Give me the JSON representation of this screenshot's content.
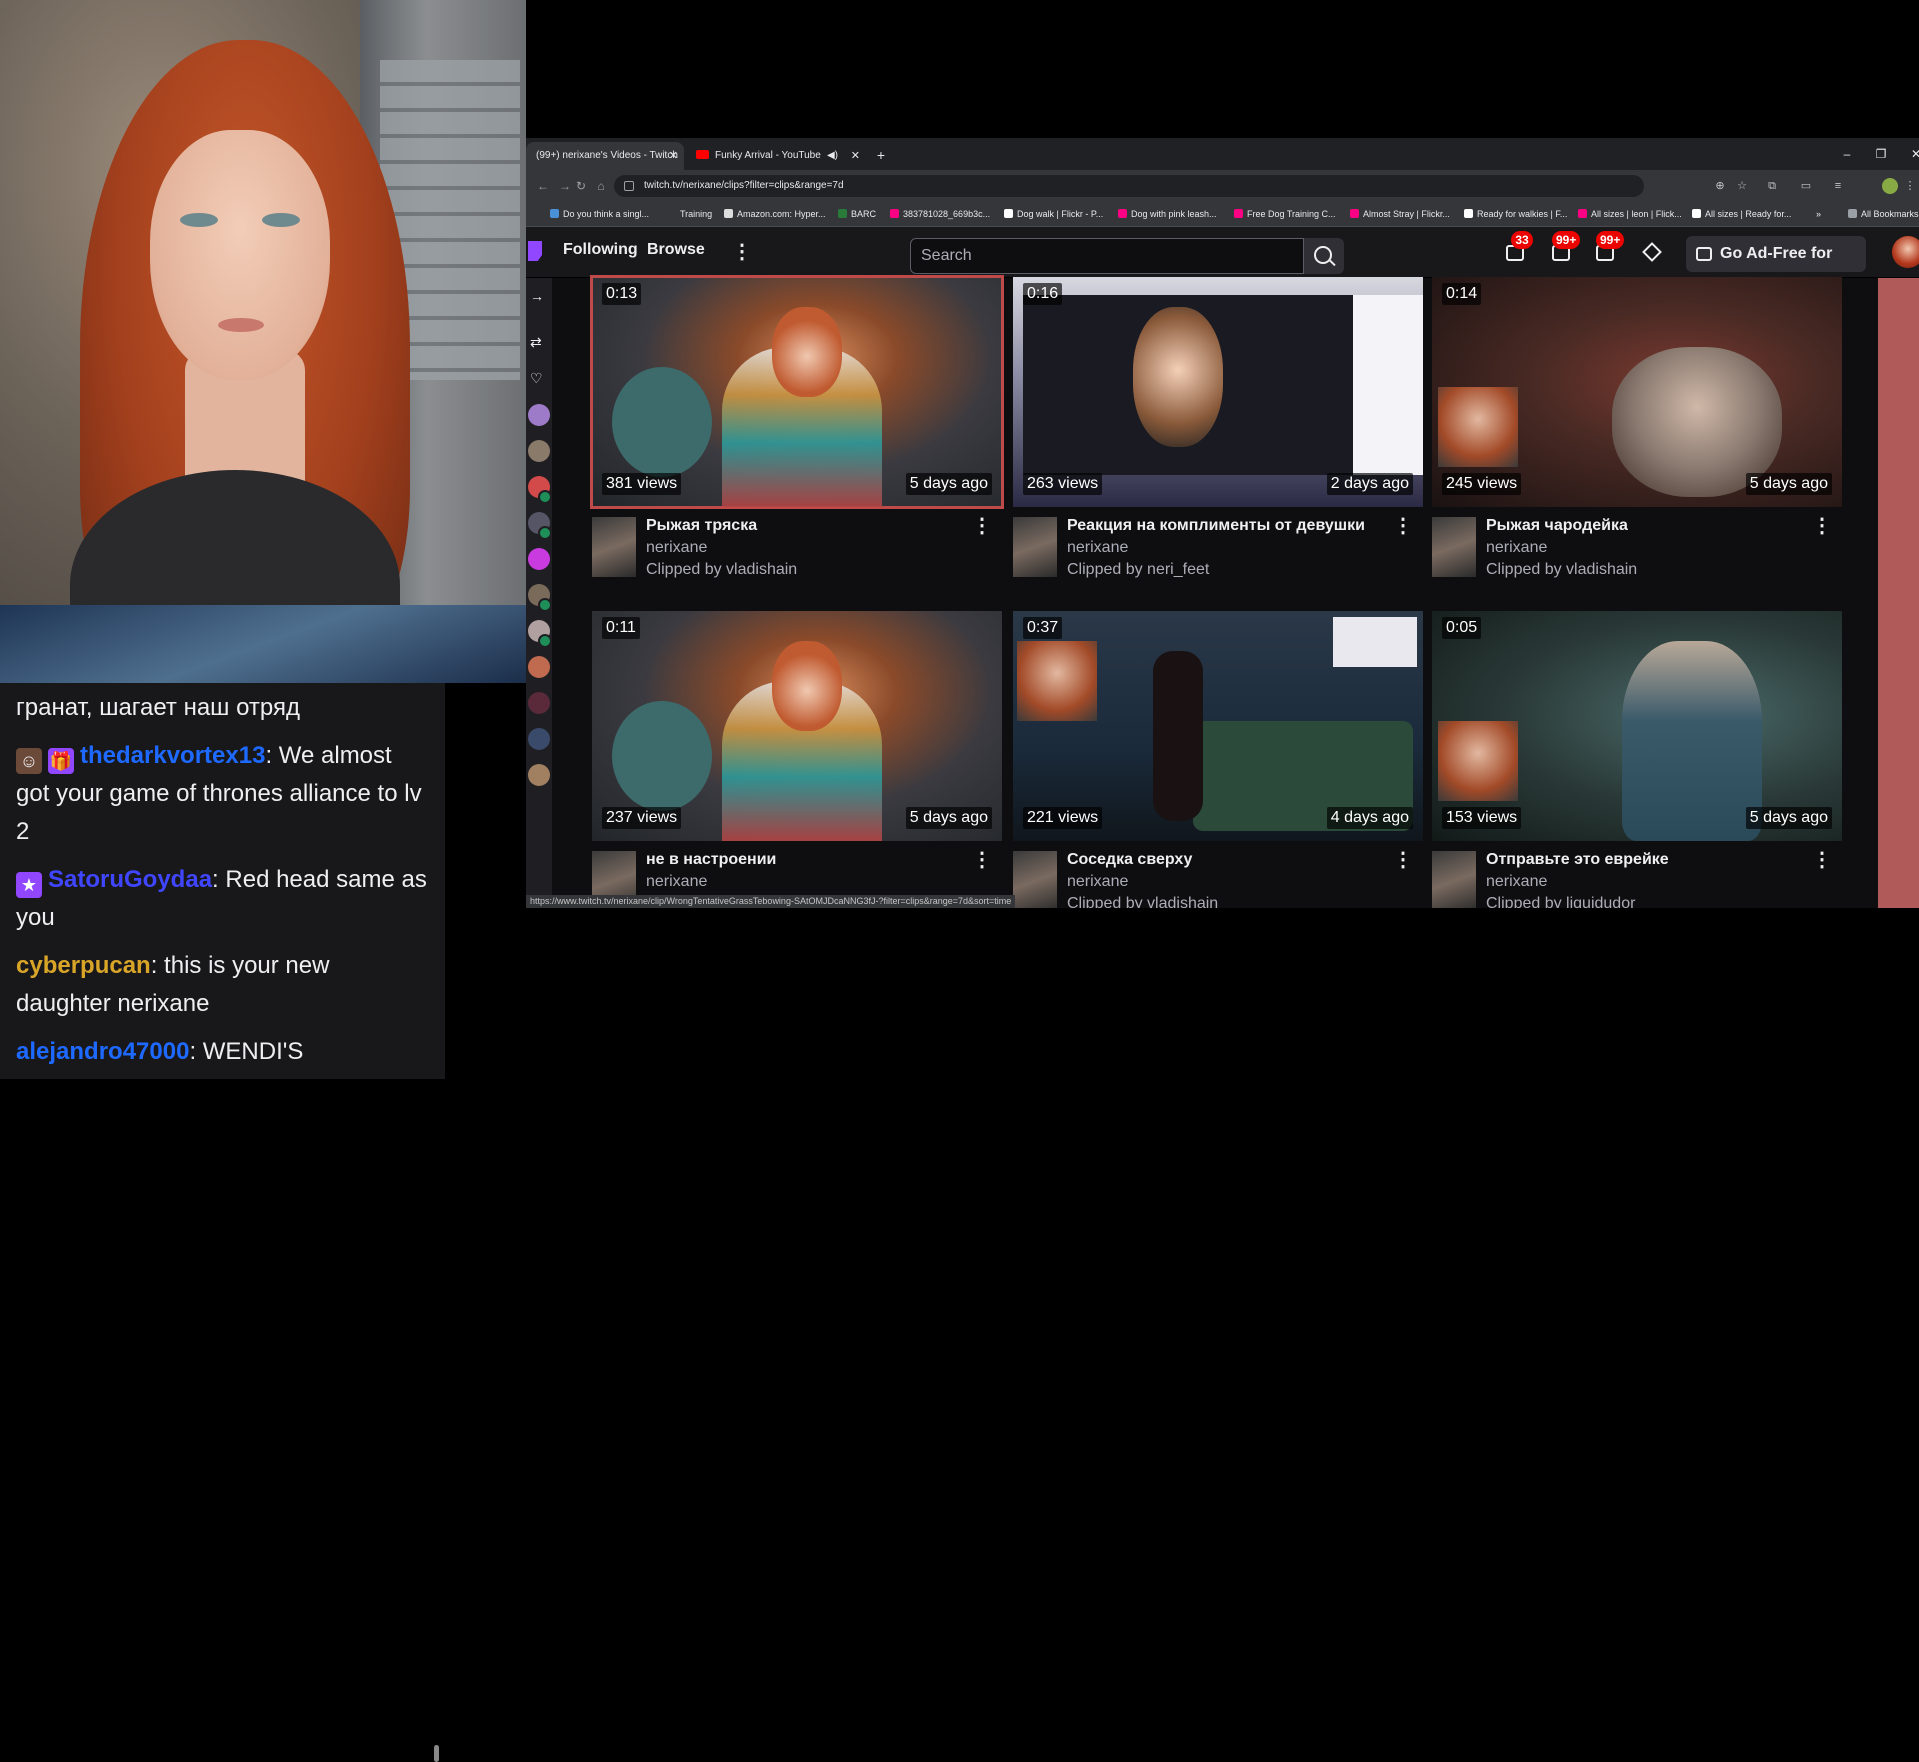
{
  "chat": {
    "partial_line": "гранат, шагает наш отряд",
    "messages": [
      {
        "user": "thedarkvortex13",
        "text": ": We almost got your game of thrones alliance to lv 2",
        "color": "#1e69ff"
      },
      {
        "user": "SatoruGoydaa",
        "text": ": Red head same as you",
        "color": "#4046ff"
      },
      {
        "user": "cyberpucan",
        "text": ": this is your new daughter nerixane",
        "color": "#d8a528"
      },
      {
        "user": "alejandro47000",
        "text": ": WENDI'S",
        "color": "#1e69ff"
      }
    ]
  },
  "browser": {
    "tabs": [
      {
        "title": "(99+) nerixane's Videos - Twitch",
        "active": true
      },
      {
        "title": "Funky Arrival - YouTube",
        "active": false
      }
    ],
    "new_tab": "+",
    "url": "twitch.tv/nerixane/clips?filter=clips&range=7d",
    "bookmarks": [
      {
        "label": "Do you think a singl...",
        "color": "#4a90d9"
      },
      {
        "label": "Training",
        "color": ""
      },
      {
        "label": "Amazon.com: Hyper...",
        "color": "#dddddd"
      },
      {
        "label": "BARC",
        "color": "#2a7a3a"
      },
      {
        "label": "383781028_669b3c...",
        "color": "#ff0084"
      },
      {
        "label": "Dog walk | Flickr - P...",
        "color": "#ffffff"
      },
      {
        "label": "Dog with pink leash...",
        "color": "#ff0084"
      },
      {
        "label": "Free Dog Training C...",
        "color": "#ff0084"
      },
      {
        "label": "Almost Stray | Flickr...",
        "color": "#ff0084"
      },
      {
        "label": "Ready for walkies | F...",
        "color": "#ffffff"
      },
      {
        "label": "All sizes | leon | Flick...",
        "color": "#ff0084"
      },
      {
        "label": "All sizes | Ready for...",
        "color": "#ffffff"
      }
    ],
    "bookmarks_more": "»",
    "all_bookmarks": "All Bookmarks",
    "status_url": "https://www.twitch.tv/nerixane/clip/WrongTentativeGrassTebowing-SAtOMJDcaNNG3fJ-?filter=clips&range=7d&sort=time"
  },
  "twitch": {
    "nav": {
      "following": "Following",
      "browse": "Browse",
      "more": "⋮"
    },
    "search_placeholder": "Search",
    "counts": {
      "inbox": "33",
      "whispers": "99+",
      "notifications": "99+"
    },
    "ad_free": "Go Ad-Free for Free",
    "accent": "#9147ff",
    "clips": [
      {
        "duration": "0:13",
        "views": "381 views",
        "ago": "5 days ago",
        "title": "Рыжая тряска",
        "channel": "nerixane",
        "clipped_by": "Clipped by vladishain"
      },
      {
        "duration": "0:16",
        "views": "263 views",
        "ago": "2 days ago",
        "title": "Реакция на комплименты от девушки",
        "channel": "nerixane",
        "clipped_by": "Clipped by neri_feet"
      },
      {
        "duration": "0:14",
        "views": "245 views",
        "ago": "5 days ago",
        "title": "Рыжая чародейка",
        "channel": "nerixane",
        "clipped_by": "Clipped by vladishain"
      },
      {
        "duration": "0:11",
        "views": "237 views",
        "ago": "5 days ago",
        "title": "не в настроении",
        "channel": "nerixane",
        "clipped_by": ""
      },
      {
        "duration": "0:37",
        "views": "221 views",
        "ago": "4 days ago",
        "title": "Соседка сверху",
        "channel": "nerixane",
        "clipped_by": "Clipped by vladishain"
      },
      {
        "duration": "0:05",
        "views": "153 views",
        "ago": "5 days ago",
        "title": "Отправьте это еврейке",
        "channel": "nerixane",
        "clipped_by": "Clipped by liquidudor"
      }
    ]
  }
}
